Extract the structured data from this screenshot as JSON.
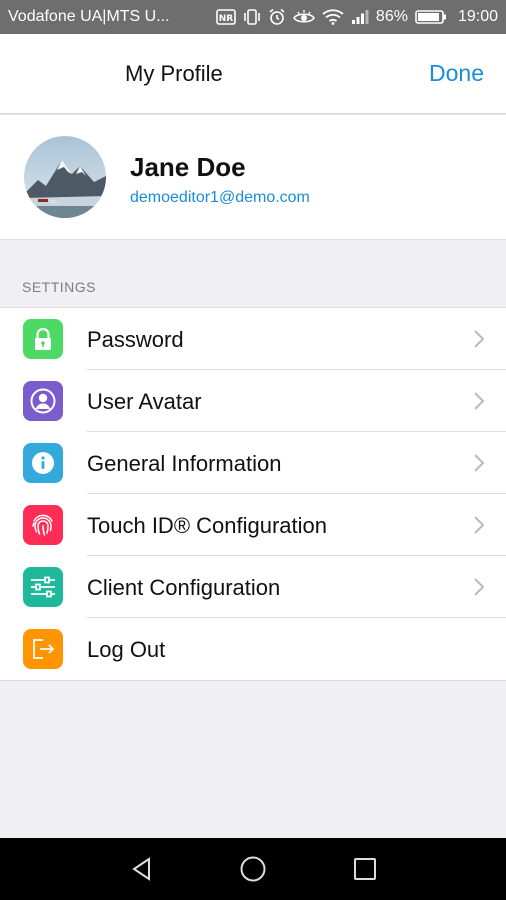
{
  "statusbar": {
    "carrier": "Vodafone UA|MTS U...",
    "battery": "86%",
    "time": "19:00"
  },
  "header": {
    "title": "My Profile",
    "done_label": "Done"
  },
  "profile": {
    "name": "Jane Doe",
    "email": "demoeditor1@demo.com"
  },
  "settings": {
    "section_title": "SETTINGS",
    "items": [
      {
        "label": "Password",
        "icon": "lock-icon",
        "color": "#4cd964"
      },
      {
        "label": "User Avatar",
        "icon": "user-icon",
        "color": "#7a5ccc"
      },
      {
        "label": "General Information",
        "icon": "info-icon",
        "color": "#34aadc"
      },
      {
        "label": "Touch ID® Configuration",
        "icon": "fingerprint-icon",
        "color": "#ff2d55"
      },
      {
        "label": "Client Configuration",
        "icon": "sliders-icon",
        "color": "#1fb89a"
      },
      {
        "label": "Log Out",
        "icon": "logout-icon",
        "color": "#ff9500"
      }
    ]
  },
  "colors": {
    "accent": "#1a8cdc",
    "background": "#efeff4"
  }
}
